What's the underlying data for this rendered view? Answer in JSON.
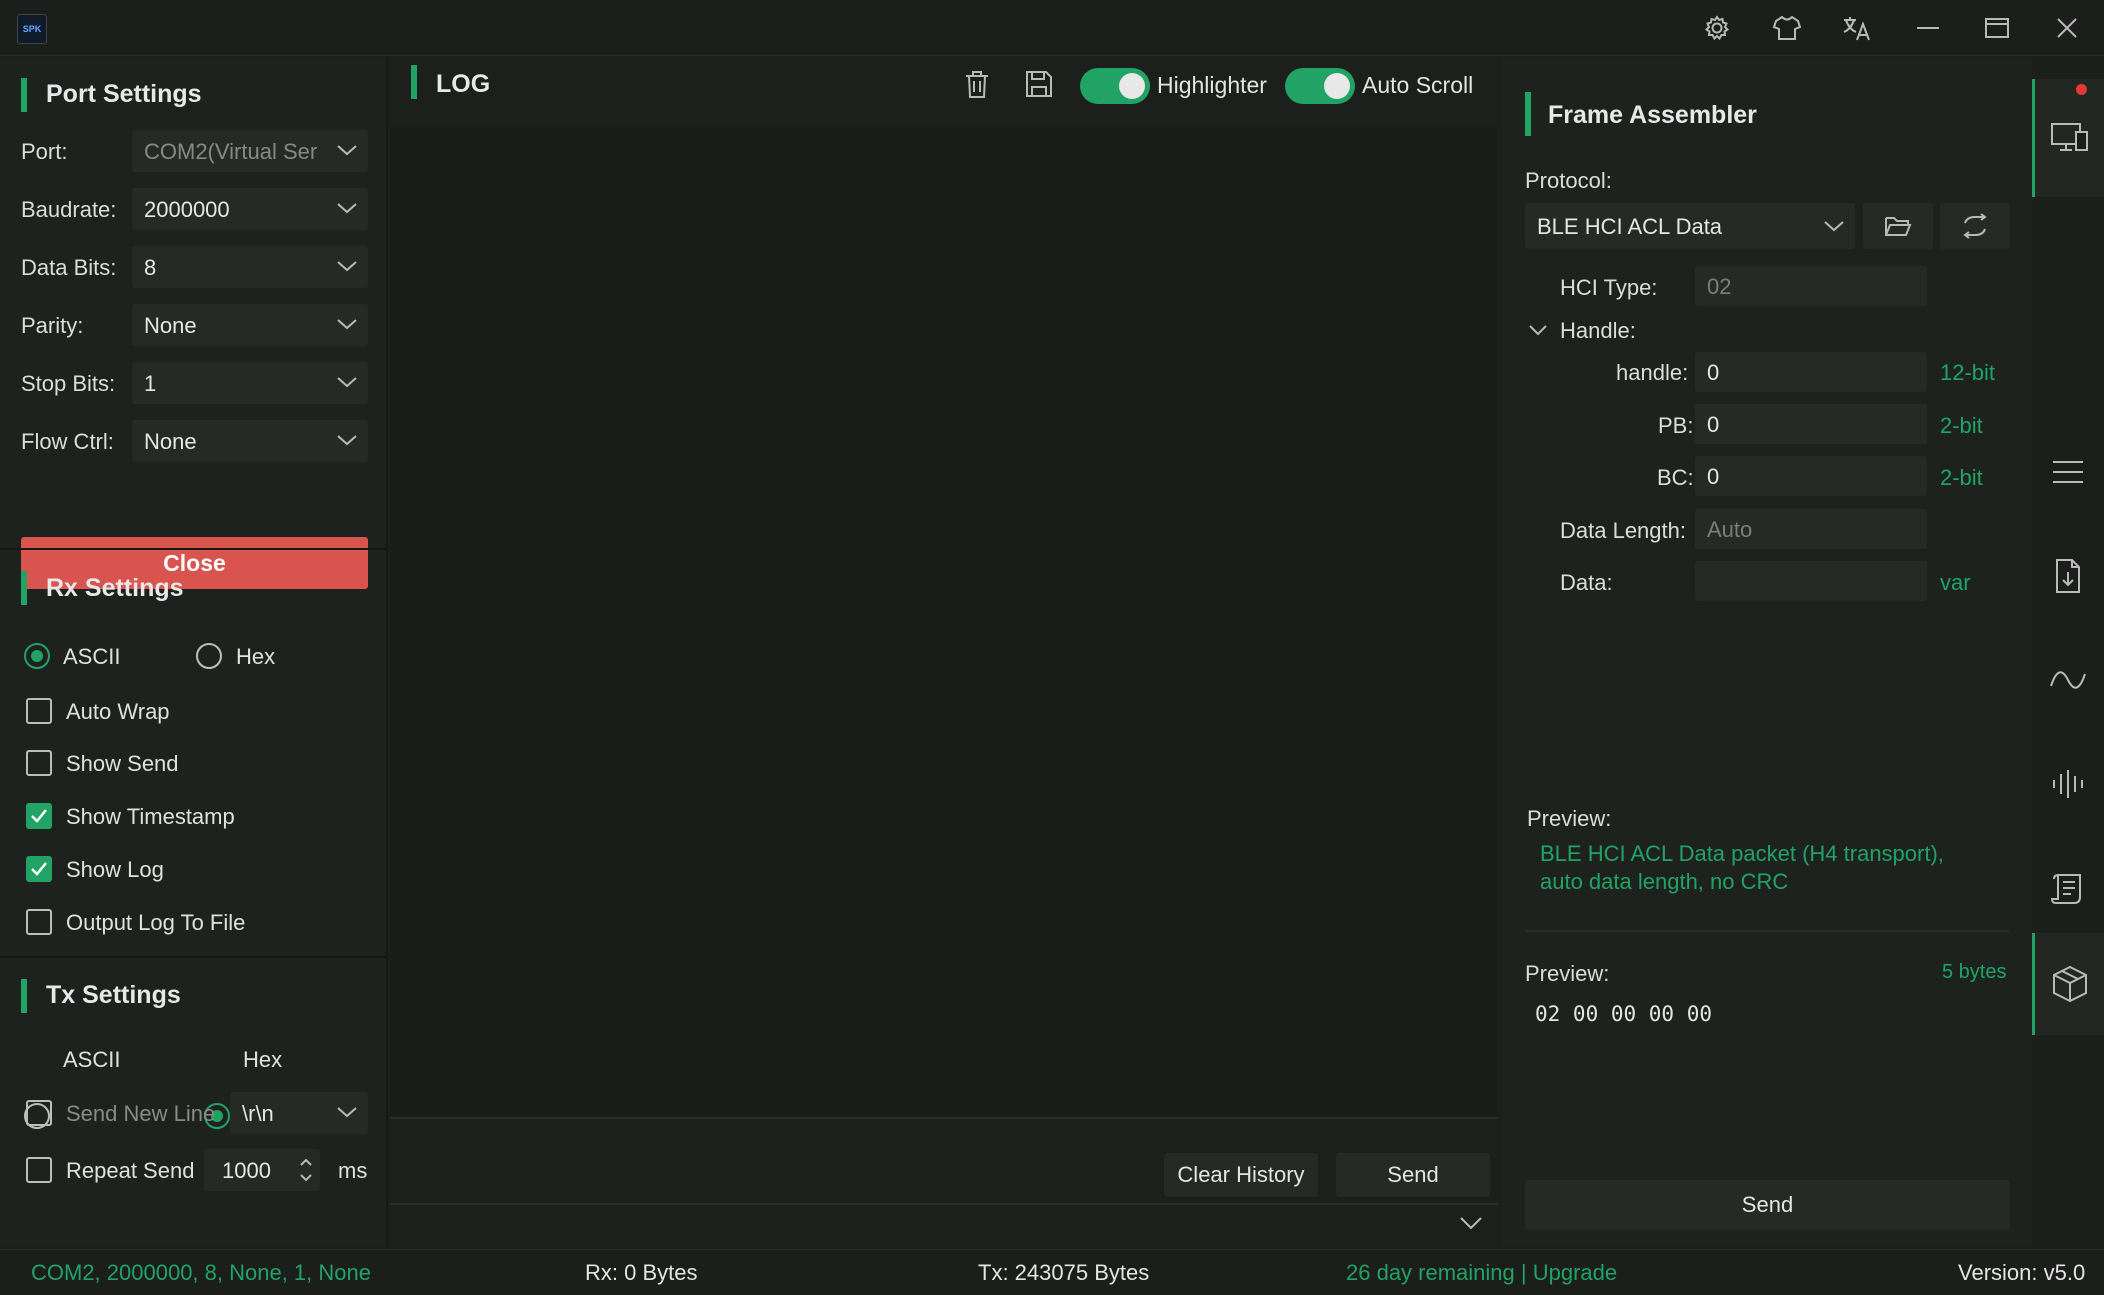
{
  "titlebar": {
    "logo_text": "SPK",
    "icons": [
      "gear-icon",
      "shirt-icon",
      "translate-icon",
      "minimize-icon",
      "maximize-icon",
      "close-icon"
    ]
  },
  "port_settings": {
    "title": "Port Settings",
    "port_label": "Port:",
    "port_value": "COM2(Virtual Ser",
    "baudrate_label": "Baudrate:",
    "baudrate_value": "2000000",
    "data_bits_label": "Data Bits:",
    "data_bits_value": "8",
    "parity_label": "Parity:",
    "parity_value": "None",
    "stop_bits_label": "Stop Bits:",
    "stop_bits_value": "1",
    "flow_ctrl_label": "Flow Ctrl:",
    "flow_ctrl_value": "None",
    "close_label": "Close"
  },
  "rx_settings": {
    "title": "Rx Settings",
    "ascii_label": "ASCII",
    "hex_label": "Hex",
    "selected_mode": "ASCII",
    "options": [
      {
        "label": "Auto Wrap",
        "checked": false
      },
      {
        "label": "Show Send",
        "checked": false
      },
      {
        "label": "Show Timestamp",
        "checked": true
      },
      {
        "label": "Show Log",
        "checked": true
      },
      {
        "label": "Output Log To File",
        "checked": false
      }
    ]
  },
  "tx_settings": {
    "title": "Tx Settings",
    "ascii_label": "ASCII",
    "hex_label": "Hex",
    "selected_mode": "Hex",
    "send_new_line_label": "Send New Line",
    "send_new_line_checked": false,
    "newline_value": "\\r\\n",
    "repeat_send_label": "Repeat Send",
    "repeat_send_checked": false,
    "repeat_interval": "1000",
    "repeat_unit": "ms"
  },
  "log": {
    "title": "LOG",
    "highlighter_label": "Highlighter",
    "highlighter_on": true,
    "auto_scroll_label": "Auto Scroll",
    "auto_scroll_on": true,
    "clear_history_label": "Clear History",
    "send_label": "Send"
  },
  "frame_assembler": {
    "title": "Frame Assembler",
    "protocol_label": "Protocol:",
    "protocol_value": "BLE HCI ACL Data",
    "hci_type_label": "HCI Type:",
    "hci_type_value": "02",
    "handle_group_label": "Handle:",
    "handle_label": "handle:",
    "handle_value": "0",
    "handle_unit": "12-bit",
    "pb_label": "PB:",
    "pb_value": "0",
    "pb_unit": "2-bit",
    "bc_label": "BC:",
    "bc_value": "0",
    "bc_unit": "2-bit",
    "data_length_label": "Data Length:",
    "data_length_value": "Auto",
    "data_label": "Data:",
    "data_value": "",
    "data_unit": "var",
    "preview_label": "Preview:",
    "preview_description_1": "BLE HCI ACL Data packet (H4 transport),",
    "preview_description_2": "auto data length, no CRC",
    "bytes_preview_label": "Preview:",
    "bytes_count": "5 bytes",
    "bytes_value": "02 00 00 00 00",
    "send_label": "Send"
  },
  "statusbar": {
    "port_summary": "COM2, 2000000, 8, None, 1, None",
    "rx": "Rx: 0 Bytes",
    "tx": "Tx: 243075 Bytes",
    "license": "26 day remaining | Upgrade",
    "version": "Version: v5.0"
  },
  "colors": {
    "accent": "#21a366",
    "close_button": "#d9534f",
    "background": "#1c1f1c"
  }
}
